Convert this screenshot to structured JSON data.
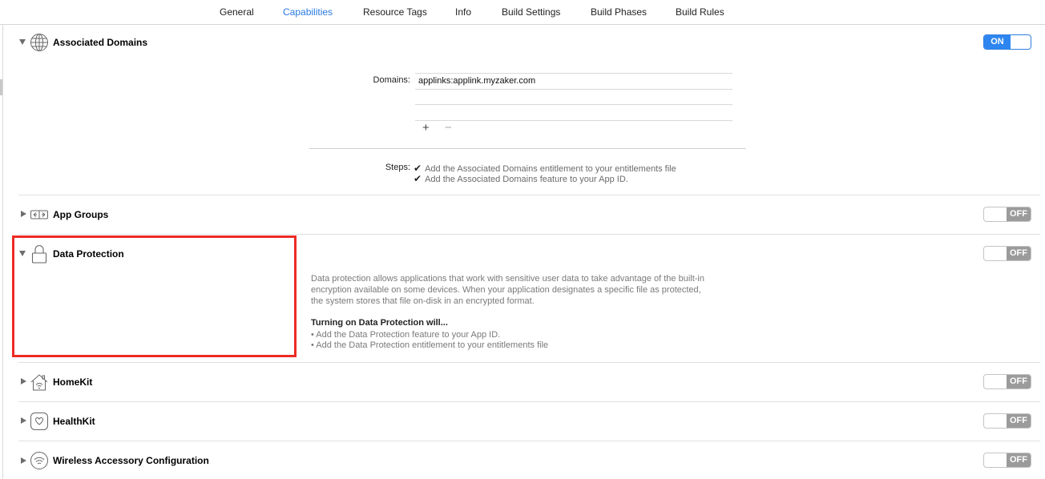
{
  "tabs": [
    {
      "label": "General"
    },
    {
      "label": "Capabilities"
    },
    {
      "label": "Resource Tags"
    },
    {
      "label": "Info"
    },
    {
      "label": "Build Settings"
    },
    {
      "label": "Build Phases"
    },
    {
      "label": "Build Rules"
    }
  ],
  "active_tab": "Capabilities",
  "accent_color": "#2d86f0",
  "highlight_color": "#ee2a24",
  "capabilities": {
    "associated_domains": {
      "title": "Associated Domains",
      "toggle": "ON",
      "icon": "globe-icon",
      "domains_label": "Domains:",
      "domains": [
        "applinks:applink.myzaker.com"
      ],
      "add_label": "+",
      "remove_label": "−",
      "steps_label": "Steps:",
      "steps": [
        "Add the Associated Domains entitlement to your entitlements file",
        "Add the Associated Domains feature to your App ID."
      ]
    },
    "app_groups": {
      "title": "App Groups",
      "toggle": "OFF",
      "icon": "app-groups-icon"
    },
    "data_protection": {
      "title": "Data Protection",
      "toggle": "OFF",
      "icon": "lock-icon",
      "description": [
        "Data protection allows applications that work with sensitive user data to take advantage of the built-in",
        "encryption available on some devices. When your application designates a specific file as protected,",
        "the system stores that file on-disk in an encrypted format."
      ],
      "turning_on": "Turning on Data Protection will...",
      "bullets": [
        "• Add the Data Protection feature to your App ID.",
        "• Add the Data Protection entitlement to your entitlements file"
      ]
    },
    "homekit": {
      "title": "HomeKit",
      "toggle": "OFF",
      "icon": "house-icon"
    },
    "healthkit": {
      "title": "HealthKit",
      "toggle": "OFF",
      "icon": "heart-icon"
    },
    "wireless_accessory": {
      "title": "Wireless Accessory Configuration",
      "toggle": "OFF",
      "icon": "wifi-icon"
    }
  }
}
